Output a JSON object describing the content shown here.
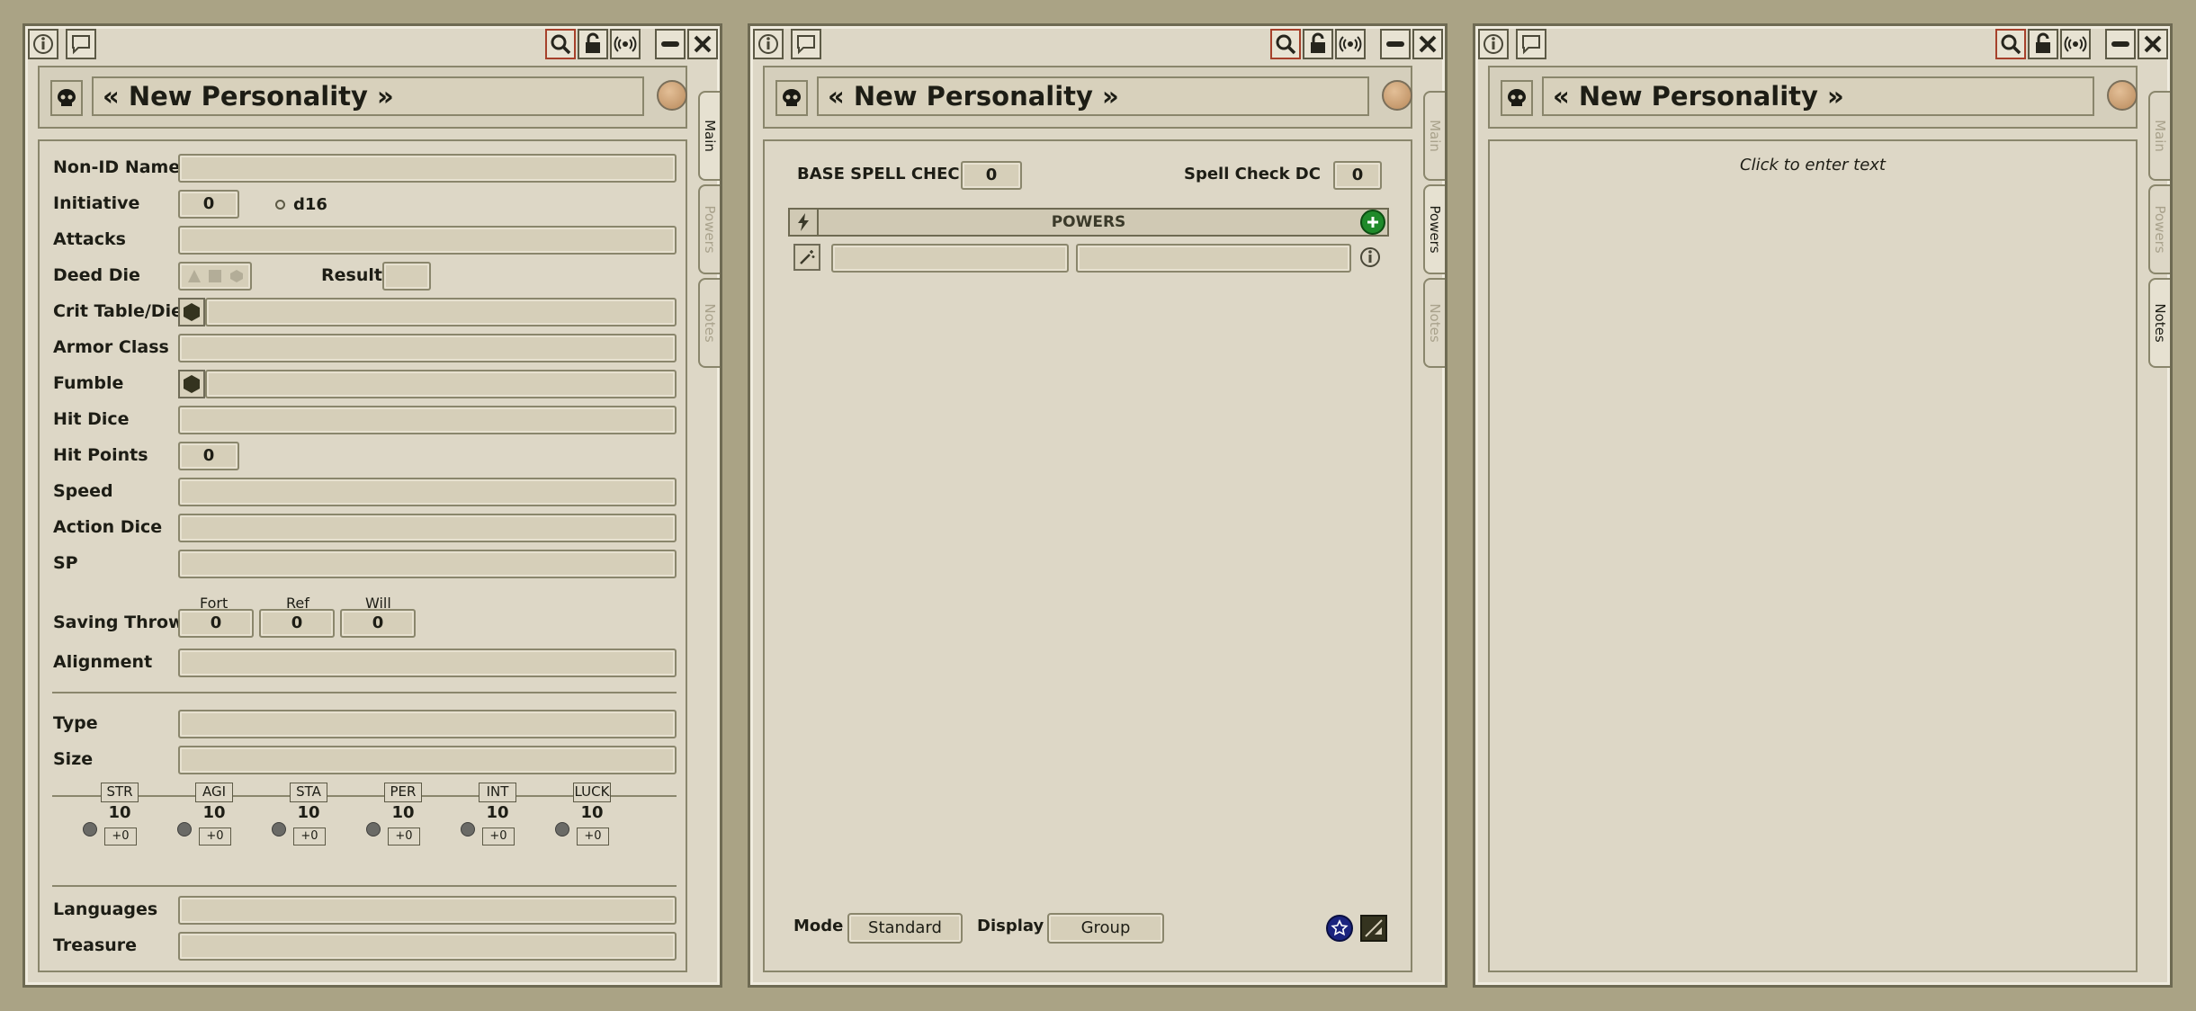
{
  "windows": [
    {
      "title": "« New Personality »",
      "tabs": [
        "Main",
        "Powers",
        "Notes"
      ],
      "active_tab": "Main"
    },
    {
      "title": "« New Personality »",
      "tabs": [
        "Main",
        "Powers",
        "Notes"
      ],
      "active_tab": "Powers"
    },
    {
      "title": "« New Personality »",
      "tabs": [
        "Main",
        "Powers",
        "Notes"
      ],
      "active_tab": "Notes"
    }
  ],
  "main": {
    "non_id_name": "Non-ID Name",
    "initiative": "Initiative",
    "initiative_value": "0",
    "initiative_die": "d16",
    "attacks": "Attacks",
    "deed_die": "Deed Die",
    "result": "Result",
    "crit_table": "Crit Table/Die",
    "armor_class": "Armor Class",
    "fumble": "Fumble",
    "hit_dice": "Hit Dice",
    "hit_points": "Hit Points",
    "hit_points_value": "0",
    "speed": "Speed",
    "action_dice": "Action Dice",
    "sp": "SP",
    "saving_throws": "Saving Throws",
    "fort": "Fort",
    "ref": "Ref",
    "will": "Will",
    "fort_value": "0",
    "ref_value": "0",
    "will_value": "0",
    "alignment": "Alignment",
    "type": "Type",
    "size": "Size",
    "abilities": [
      {
        "name": "STR",
        "score": "10",
        "mod": "+0"
      },
      {
        "name": "AGI",
        "score": "10",
        "mod": "+0"
      },
      {
        "name": "STA",
        "score": "10",
        "mod": "+0"
      },
      {
        "name": "PER",
        "score": "10",
        "mod": "+0"
      },
      {
        "name": "INT",
        "score": "10",
        "mod": "+0"
      },
      {
        "name": "LUCK",
        "score": "10",
        "mod": "+0"
      }
    ],
    "languages": "Languages",
    "treasure": "Treasure"
  },
  "powers": {
    "base_spell_check": "BASE SPELL CHECK",
    "base_spell_check_value": "0",
    "spell_check_dc": "Spell Check DC",
    "spell_check_dc_value": "0",
    "header": "POWERS",
    "mode_label": "Mode",
    "mode_value": "Standard",
    "display_label": "Display",
    "display_value": "Group"
  },
  "notes": {
    "placeholder": "Click to enter text"
  },
  "icons": {
    "info": "info-icon",
    "chat": "chat-icon",
    "search": "search-icon",
    "lock": "lock-icon",
    "broadcast": "broadcast-icon",
    "minimize": "minimize-icon",
    "close": "close-icon",
    "skull": "skull-icon"
  },
  "colors": {
    "background": "#aaa385",
    "window": "#ddd7c6",
    "add_button": "#1f8a2a",
    "star_button": "#1a237e"
  }
}
